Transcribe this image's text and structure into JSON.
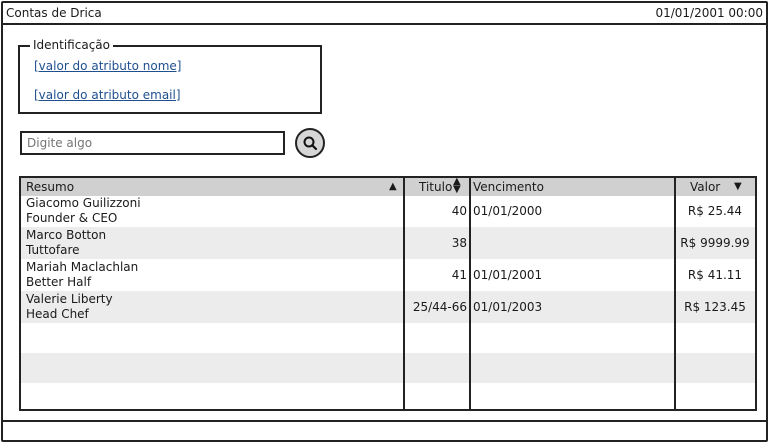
{
  "window": {
    "title": "Contas de Drica",
    "datetime": "01/01/2001 00:00"
  },
  "identificacao": {
    "legend": "Identificação",
    "nome_link": "[valor do atributo nome]",
    "email_link": "[valor do atributo email]"
  },
  "search": {
    "placeholder": "Digite algo",
    "icon": "search-icon"
  },
  "table": {
    "columns": {
      "resumo": "Resumo",
      "titulo": "Titulo",
      "vencimento": "Vencimento",
      "valor": "Valor"
    },
    "rows": [
      {
        "line1": "Giacomo Guilizzoni",
        "line2": "Founder & CEO",
        "titulo": "40",
        "vencimento": "01/01/2000",
        "valor": "R$ 25.44"
      },
      {
        "line1": "Marco Botton",
        "line2": "Tuttofare",
        "titulo": "38",
        "vencimento": "",
        "valor": "R$ 9999.99"
      },
      {
        "line1": "Mariah Maclachlan",
        "line2": "Better Half",
        "titulo": "41",
        "vencimento": "01/01/2001",
        "valor": "R$ 41.11"
      },
      {
        "line1": "Valerie Liberty",
        "line2": "Head Chef",
        "titulo": "25/44-66",
        "vencimento": "01/01/2003",
        "valor": "R$ 123.45"
      }
    ]
  },
  "colors": {
    "header_bg": "#d0d0d0",
    "alt_row_bg": "#ececec",
    "link": "#1f4f8f",
    "border": "#222222"
  }
}
